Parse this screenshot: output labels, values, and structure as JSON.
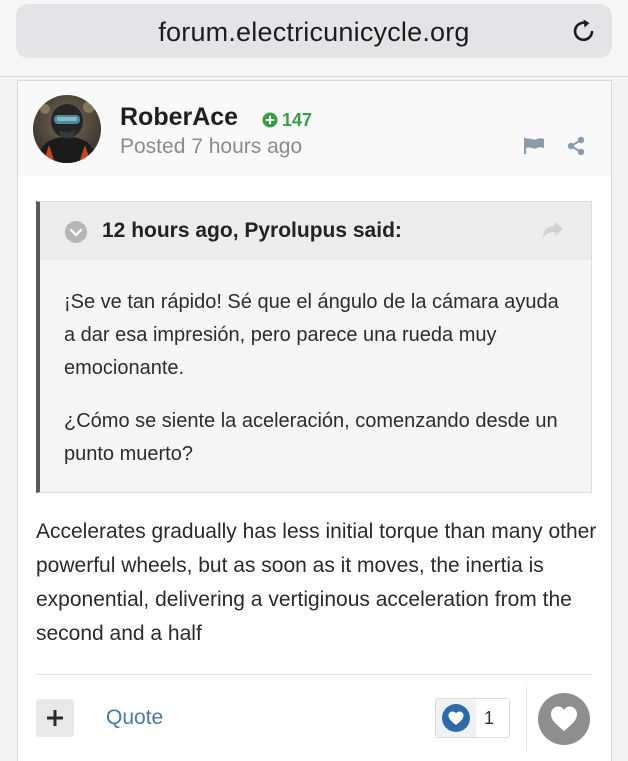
{
  "browser": {
    "url": "forum.electricunicycle.org",
    "reload_icon": "reload-icon"
  },
  "post": {
    "author": "RoberAce",
    "reputation": "147",
    "posted": "Posted 7 hours ago",
    "quote": {
      "citation": "12 hours ago, Pyrolupus said:",
      "paragraphs": [
        "¡Se ve tan rápido! Sé que el ángulo de la cámara ayuda a dar esa impresión, pero parece una rueda muy emocionante.",
        "¿Cómo se siente la aceleración, comenzando desde un punto muerto?"
      ]
    },
    "body": "Accelerates gradually has less initial torque than many other powerful wheels, but as soon as it moves, the inertia is exponential, delivering a vertiginous acceleration from the second and a half",
    "footer": {
      "quote_label": "Quote",
      "like_count": "1"
    }
  },
  "colors": {
    "reputation_green": "#3a9b49",
    "link_blue": "#4a79a7",
    "like_heart_blue": "#2d6aa6"
  }
}
